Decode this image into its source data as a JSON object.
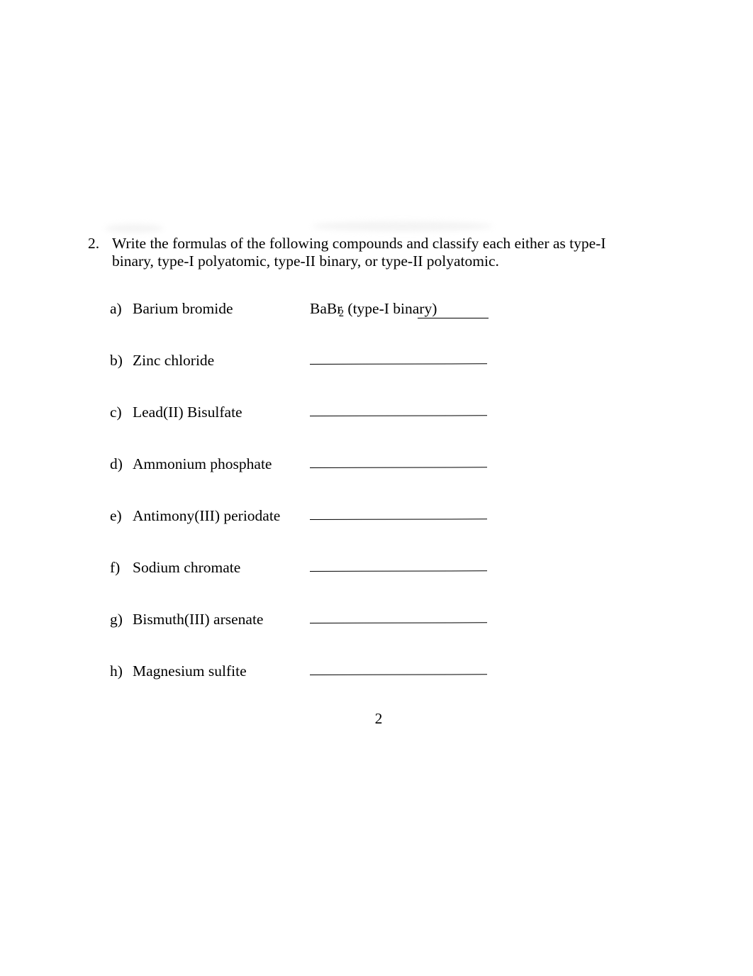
{
  "document": {
    "page_number": "2",
    "question": {
      "number": "2.",
      "text": "Write the formulas of the following compounds and classify each either as type-I binary, type-I polyatomic, type-II binary, or type-II polyatomic."
    },
    "items": [
      {
        "letter": "a)",
        "name": "Barium bromide",
        "answer_prefix": "BaBr",
        "answer_subscript": "2",
        "answer_suffix": " (type-I binary)",
        "answered": true
      },
      {
        "letter": "b)",
        "name": "Zinc chloride",
        "answer_prefix": "",
        "answer_subscript": "",
        "answer_suffix": "",
        "answered": false
      },
      {
        "letter": "c)",
        "name": "Lead(II) Bisulfate",
        "answer_prefix": "",
        "answer_subscript": "",
        "answer_suffix": "",
        "answered": false
      },
      {
        "letter": "d)",
        "name": "Ammonium phosphate",
        "answer_prefix": "",
        "answer_subscript": "",
        "answer_suffix": "",
        "answered": false
      },
      {
        "letter": "e)",
        "name": "Antimony(III) periodate",
        "answer_prefix": "",
        "answer_subscript": "",
        "answer_suffix": "",
        "answered": false
      },
      {
        "letter": "f)",
        "name": "Sodium chromate",
        "answer_prefix": "",
        "answer_subscript": "",
        "answer_suffix": "",
        "answered": false
      },
      {
        "letter": "g)",
        "name": "Bismuth(III) arsenate",
        "answer_prefix": "",
        "answer_subscript": "",
        "answer_suffix": "",
        "answered": false
      },
      {
        "letter": "h)",
        "name": "Magnesium sulfite",
        "answer_prefix": "",
        "answer_subscript": "",
        "answer_suffix": "",
        "answered": false
      }
    ]
  },
  "colors": {
    "page_background": "#ffffff",
    "text": "#000000",
    "rule": "#000000",
    "smudge": "#f4f4f4"
  }
}
